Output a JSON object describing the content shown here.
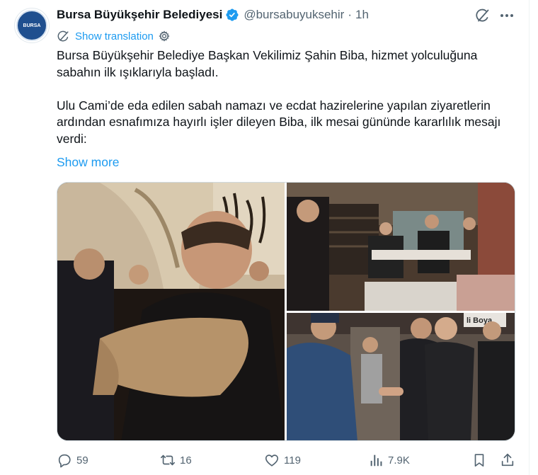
{
  "author": {
    "name": "Bursa Büyükşehir Belediyesi",
    "handle": "@bursabuyuksehir",
    "separator": "·",
    "time": "1h",
    "avatar_text": "BURSA"
  },
  "translate": {
    "label": "Show translation"
  },
  "tweet": {
    "paragraph1": "Bursa Büyükşehir Belediye Başkan Vekilimiz Şahin Biba, hizmet yolculuğuna sabahın ilk ışıklarıyla başladı.",
    "paragraph2": "Ulu Cami’de eda edilen sabah namazı ve ecdat hazirelerine yapılan ziyaretlerin ardından esnafımıza hayırlı işler dileyen Biba, ilk mesai gününde kararlılık mesajı verdi:",
    "show_more": "Show more"
  },
  "media": {
    "photo3_sign": "li Boya"
  },
  "actions": {
    "replies": "59",
    "reposts": "16",
    "likes": "119",
    "views": "7.9K"
  },
  "colors": {
    "accent": "#1d9bf0",
    "muted": "#536471",
    "text": "#0f1419",
    "verified": "#1d9bf0"
  },
  "icons": [
    "verified-badge-icon",
    "grok-icon",
    "more-icon",
    "translate-globe-icon",
    "settings-gear-icon",
    "reply-icon",
    "repost-icon",
    "like-icon",
    "views-icon",
    "bookmark-icon",
    "share-icon"
  ]
}
